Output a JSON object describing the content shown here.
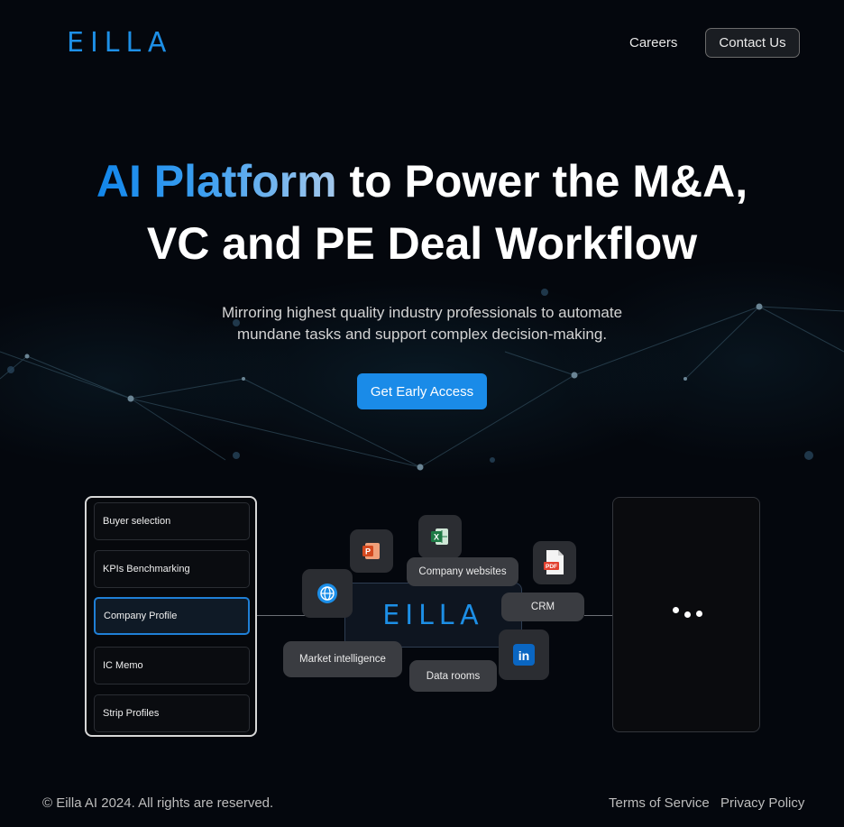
{
  "header": {
    "logo_text": "EILLA",
    "nav_careers": "Careers",
    "contact_label": "Contact Us"
  },
  "hero": {
    "title_accent": "AI Platform",
    "title_rest_line1": " to Power the M&A,",
    "title_line2": "VC and PE Deal Workflow",
    "subtitle_line1": "Mirroring highest quality industry professionals to automate",
    "subtitle_line2": "mundane tasks and support complex decision-making.",
    "cta_label": "Get Early Access"
  },
  "diagram": {
    "tasks": [
      {
        "label": "Buyer selection",
        "active": false
      },
      {
        "label": "KPIs Benchmarking",
        "active": false
      },
      {
        "label": "Company Profile",
        "active": true
      },
      {
        "label": "IC Memo",
        "active": false
      },
      {
        "label": "Strip Profiles",
        "active": false
      }
    ],
    "center_logo": "EILLA",
    "sources": {
      "company_websites": "Company websites",
      "crm": "CRM",
      "market_intelligence": "Market intelligence",
      "data_rooms": "Data rooms"
    },
    "icons": [
      "powerpoint-icon",
      "excel-icon",
      "pdf-icon",
      "globe-icon",
      "linkedin-icon"
    ],
    "pdf_icon_text": "PDF",
    "linkedin_icon_text": "in"
  },
  "footer": {
    "copyright": "© Eilla AI 2024. All rights are reserved.",
    "terms": "Terms of Service",
    "privacy": "Privacy Policy"
  },
  "colors": {
    "brand_blue": "#1d8fe6",
    "cta_blue": "#1a8be8",
    "background": "#04070d"
  }
}
